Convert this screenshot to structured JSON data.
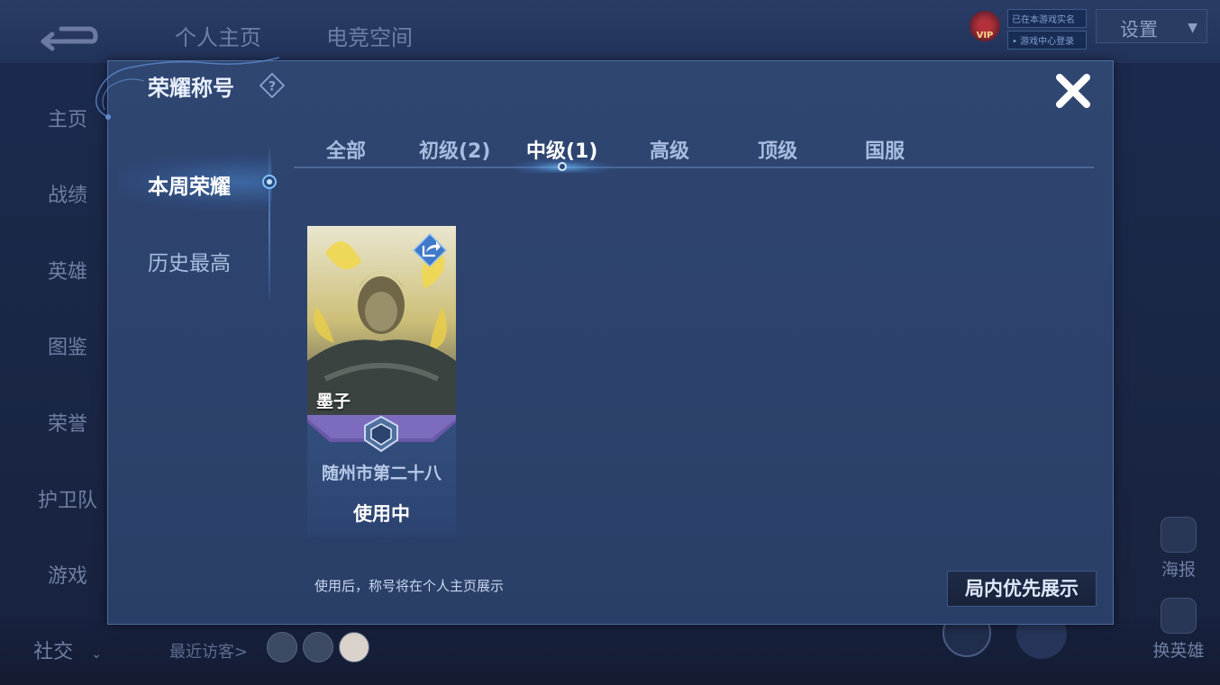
{
  "background": {
    "top_tabs": [
      "个人主页",
      "电竞空间"
    ],
    "vip_label": "VIP",
    "vip_lines": [
      "已在本游戏实名",
      "• 游戏中心登录"
    ],
    "settings_label": "设置",
    "left_nav": [
      "主页",
      "战绩",
      "英雄",
      "图鉴",
      "荣誉",
      "护卫队",
      "游戏",
      "社交"
    ],
    "recent_visitors_label": "最近访客>",
    "right_buttons": [
      "海报",
      "换英雄"
    ]
  },
  "modal": {
    "title": "荣耀称号",
    "side_tabs": [
      "本周荣耀",
      "历史最高"
    ],
    "active_side_tab": "本周荣耀",
    "tabs": [
      "全部",
      "初级(2)",
      "中级(1)",
      "高级",
      "顶级",
      "国服"
    ],
    "active_tab": "中级(1)",
    "card": {
      "hero_name": "墨子",
      "title_text": "随州市第二十八",
      "status": "使用中"
    },
    "hint": "使用后，称号将在个人主页展示",
    "priority_button": "局内优先展示"
  },
  "colors": {
    "modal_bg": "#2f4671",
    "accent": "#7fc4ff",
    "badge_purple": "#6a58a8"
  }
}
